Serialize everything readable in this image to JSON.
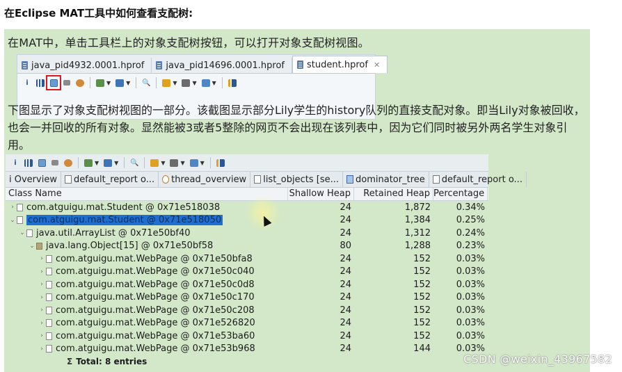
{
  "heading": "在Eclipse MAT工具中如何查看支配树:",
  "intro_text": "在MAT中，单击工具栏上的对象支配树按钮，可以打开对象支配树视图。",
  "editor_tabs": [
    {
      "label": "java_pid4932.0001.hprof",
      "active": false
    },
    {
      "label": "java_pid14696.0001.hprof",
      "active": false
    },
    {
      "label": "student.hprof",
      "active": true,
      "close": "✕"
    }
  ],
  "toolbar_icons": [
    "info-icon",
    "histogram-icon",
    "dominator-tree-icon",
    "oql-icon",
    "thread-overview-icon",
    "run-report-icon",
    "query-browser-icon",
    "search-icon",
    "heap-dump-overview-icon",
    "export-icon",
    "chart-icon"
  ],
  "description_text": "下图显示了对象支配树视图的一部分。该截图显示部分Lily学生的history队列的直接支配对象。即当Lily对象被回收，也会一并回收的所有对象。显然能被3或者5整除的网页不会出现在该列表中，因为它们同时被另外两名学生对象引用。",
  "view_tabs": [
    {
      "label": "i Overview"
    },
    {
      "label": "default_report  o..."
    },
    {
      "label": "thread_overview"
    },
    {
      "label": "list_objects  [se..."
    },
    {
      "label": "dominator_tree"
    },
    {
      "label": "default_report  o..."
    }
  ],
  "columns": [
    "Class Name",
    "Shallow Heap",
    "Retained Heap",
    "Percentage"
  ],
  "rows": [
    {
      "indent": 1,
      "arrow": "›",
      "icon": "obj",
      "name": "com.atguigu.mat.Student @ 0x71e518038",
      "shallow": "24",
      "retained": "1,872",
      "pct": "0.34%",
      "selected": false
    },
    {
      "indent": 1,
      "arrow": "⌄",
      "icon": "obj",
      "name": "com.atguigu.mat.Student @ 0x71e518050",
      "shallow": "24",
      "retained": "1,384",
      "pct": "0.25%",
      "selected": true
    },
    {
      "indent": 2,
      "arrow": "⌄",
      "icon": "obj",
      "name": "java.util.ArrayList @ 0x71e50bf40",
      "shallow": "24",
      "retained": "1,312",
      "pct": "0.24%",
      "selected": false
    },
    {
      "indent": 3,
      "arrow": "⌄",
      "icon": "arr",
      "name": "java.lang.Object[15] @ 0x71e50bf58",
      "shallow": "80",
      "retained": "1,288",
      "pct": "0.23%",
      "selected": false
    },
    {
      "indent": 4,
      "arrow": "›",
      "icon": "obj",
      "name": "com.atguigu.mat.WebPage @ 0x71e50bfa8",
      "shallow": "24",
      "retained": "152",
      "pct": "0.03%",
      "selected": false
    },
    {
      "indent": 4,
      "arrow": "›",
      "icon": "obj",
      "name": "com.atguigu.mat.WebPage @ 0x71e50c040",
      "shallow": "24",
      "retained": "152",
      "pct": "0.03%",
      "selected": false
    },
    {
      "indent": 4,
      "arrow": "›",
      "icon": "obj",
      "name": "com.atguigu.mat.WebPage @ 0x71e50c0d8",
      "shallow": "24",
      "retained": "152",
      "pct": "0.03%",
      "selected": false
    },
    {
      "indent": 4,
      "arrow": "›",
      "icon": "obj",
      "name": "com.atguigu.mat.WebPage @ 0x71e50c170",
      "shallow": "24",
      "retained": "152",
      "pct": "0.03%",
      "selected": false
    },
    {
      "indent": 4,
      "arrow": "›",
      "icon": "obj",
      "name": "com.atguigu.mat.WebPage @ 0x71e50c208",
      "shallow": "24",
      "retained": "152",
      "pct": "0.03%",
      "selected": false
    },
    {
      "indent": 4,
      "arrow": "›",
      "icon": "obj",
      "name": "com.atguigu.mat.WebPage @ 0x71e526820",
      "shallow": "24",
      "retained": "152",
      "pct": "0.03%",
      "selected": false
    },
    {
      "indent": 4,
      "arrow": "›",
      "icon": "obj",
      "name": "com.atguigu.mat.WebPage @ 0x71e53ba60",
      "shallow": "24",
      "retained": "152",
      "pct": "0.03%",
      "selected": false
    },
    {
      "indent": 4,
      "arrow": "›",
      "icon": "obj",
      "name": "com.atguigu.mat.WebPage @ 0x71e53b968",
      "shallow": "24",
      "retained": "144",
      "pct": "0.03%",
      "selected": false
    }
  ],
  "total_symbol": "Σ",
  "total_label": "Total: 8 entries",
  "watermark": "CSDN @weixin_43967582",
  "colors": {
    "slide_bg": "#d3e8c8",
    "selection": "#1f6fd0",
    "highlight_box": "#e0191e"
  }
}
